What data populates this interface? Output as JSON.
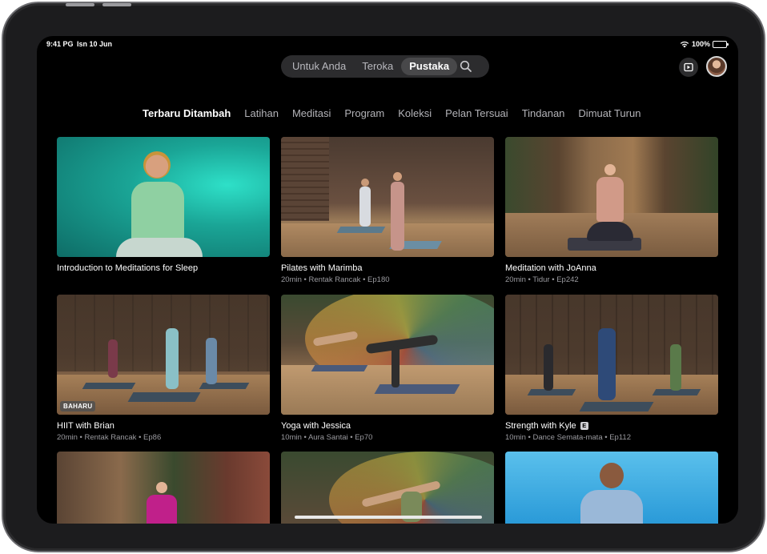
{
  "status": {
    "time": "9:41 PG",
    "date": "Isn 10 Jun",
    "battery": "100%"
  },
  "tabs": [
    {
      "label": "Untuk Anda",
      "active": false
    },
    {
      "label": "Teroka",
      "active": false
    },
    {
      "label": "Pustaka",
      "active": true
    }
  ],
  "categories": [
    {
      "label": "Terbaru Ditambah",
      "active": true
    },
    {
      "label": "Latihan"
    },
    {
      "label": "Meditasi"
    },
    {
      "label": "Program"
    },
    {
      "label": "Koleksi"
    },
    {
      "label": "Pelan Tersuai"
    },
    {
      "label": "Tindanan"
    },
    {
      "label": "Dimuat Turun"
    }
  ],
  "cards": [
    {
      "title": "Introduction to Meditations for Sleep",
      "meta": ""
    },
    {
      "title": "Pilates with Marimba",
      "meta": "20min • Rentak Rancak • Ep180"
    },
    {
      "title": "Meditation with JoAnna",
      "meta": "20min • Tidur • Ep242"
    },
    {
      "title": "HIIT with Brian",
      "meta": "20min • Rentak Rancak • Ep86",
      "tag": "BAHARU"
    },
    {
      "title": "Yoga with Jessica",
      "meta": "10min • Aura Santai • Ep70"
    },
    {
      "title": "Strength with Kyle",
      "meta": "10min • Dance Semata-mata • Ep112",
      "badge": "E"
    }
  ],
  "colors": {
    "background": "#000000",
    "segment_bg": "#2c2c2e",
    "segment_active": "#48484a",
    "teal": "#1fb8a6",
    "sky": "#2aa0d8"
  },
  "icons": [
    "wifi-icon",
    "battery-icon",
    "search-icon",
    "play-icon",
    "avatar"
  ]
}
